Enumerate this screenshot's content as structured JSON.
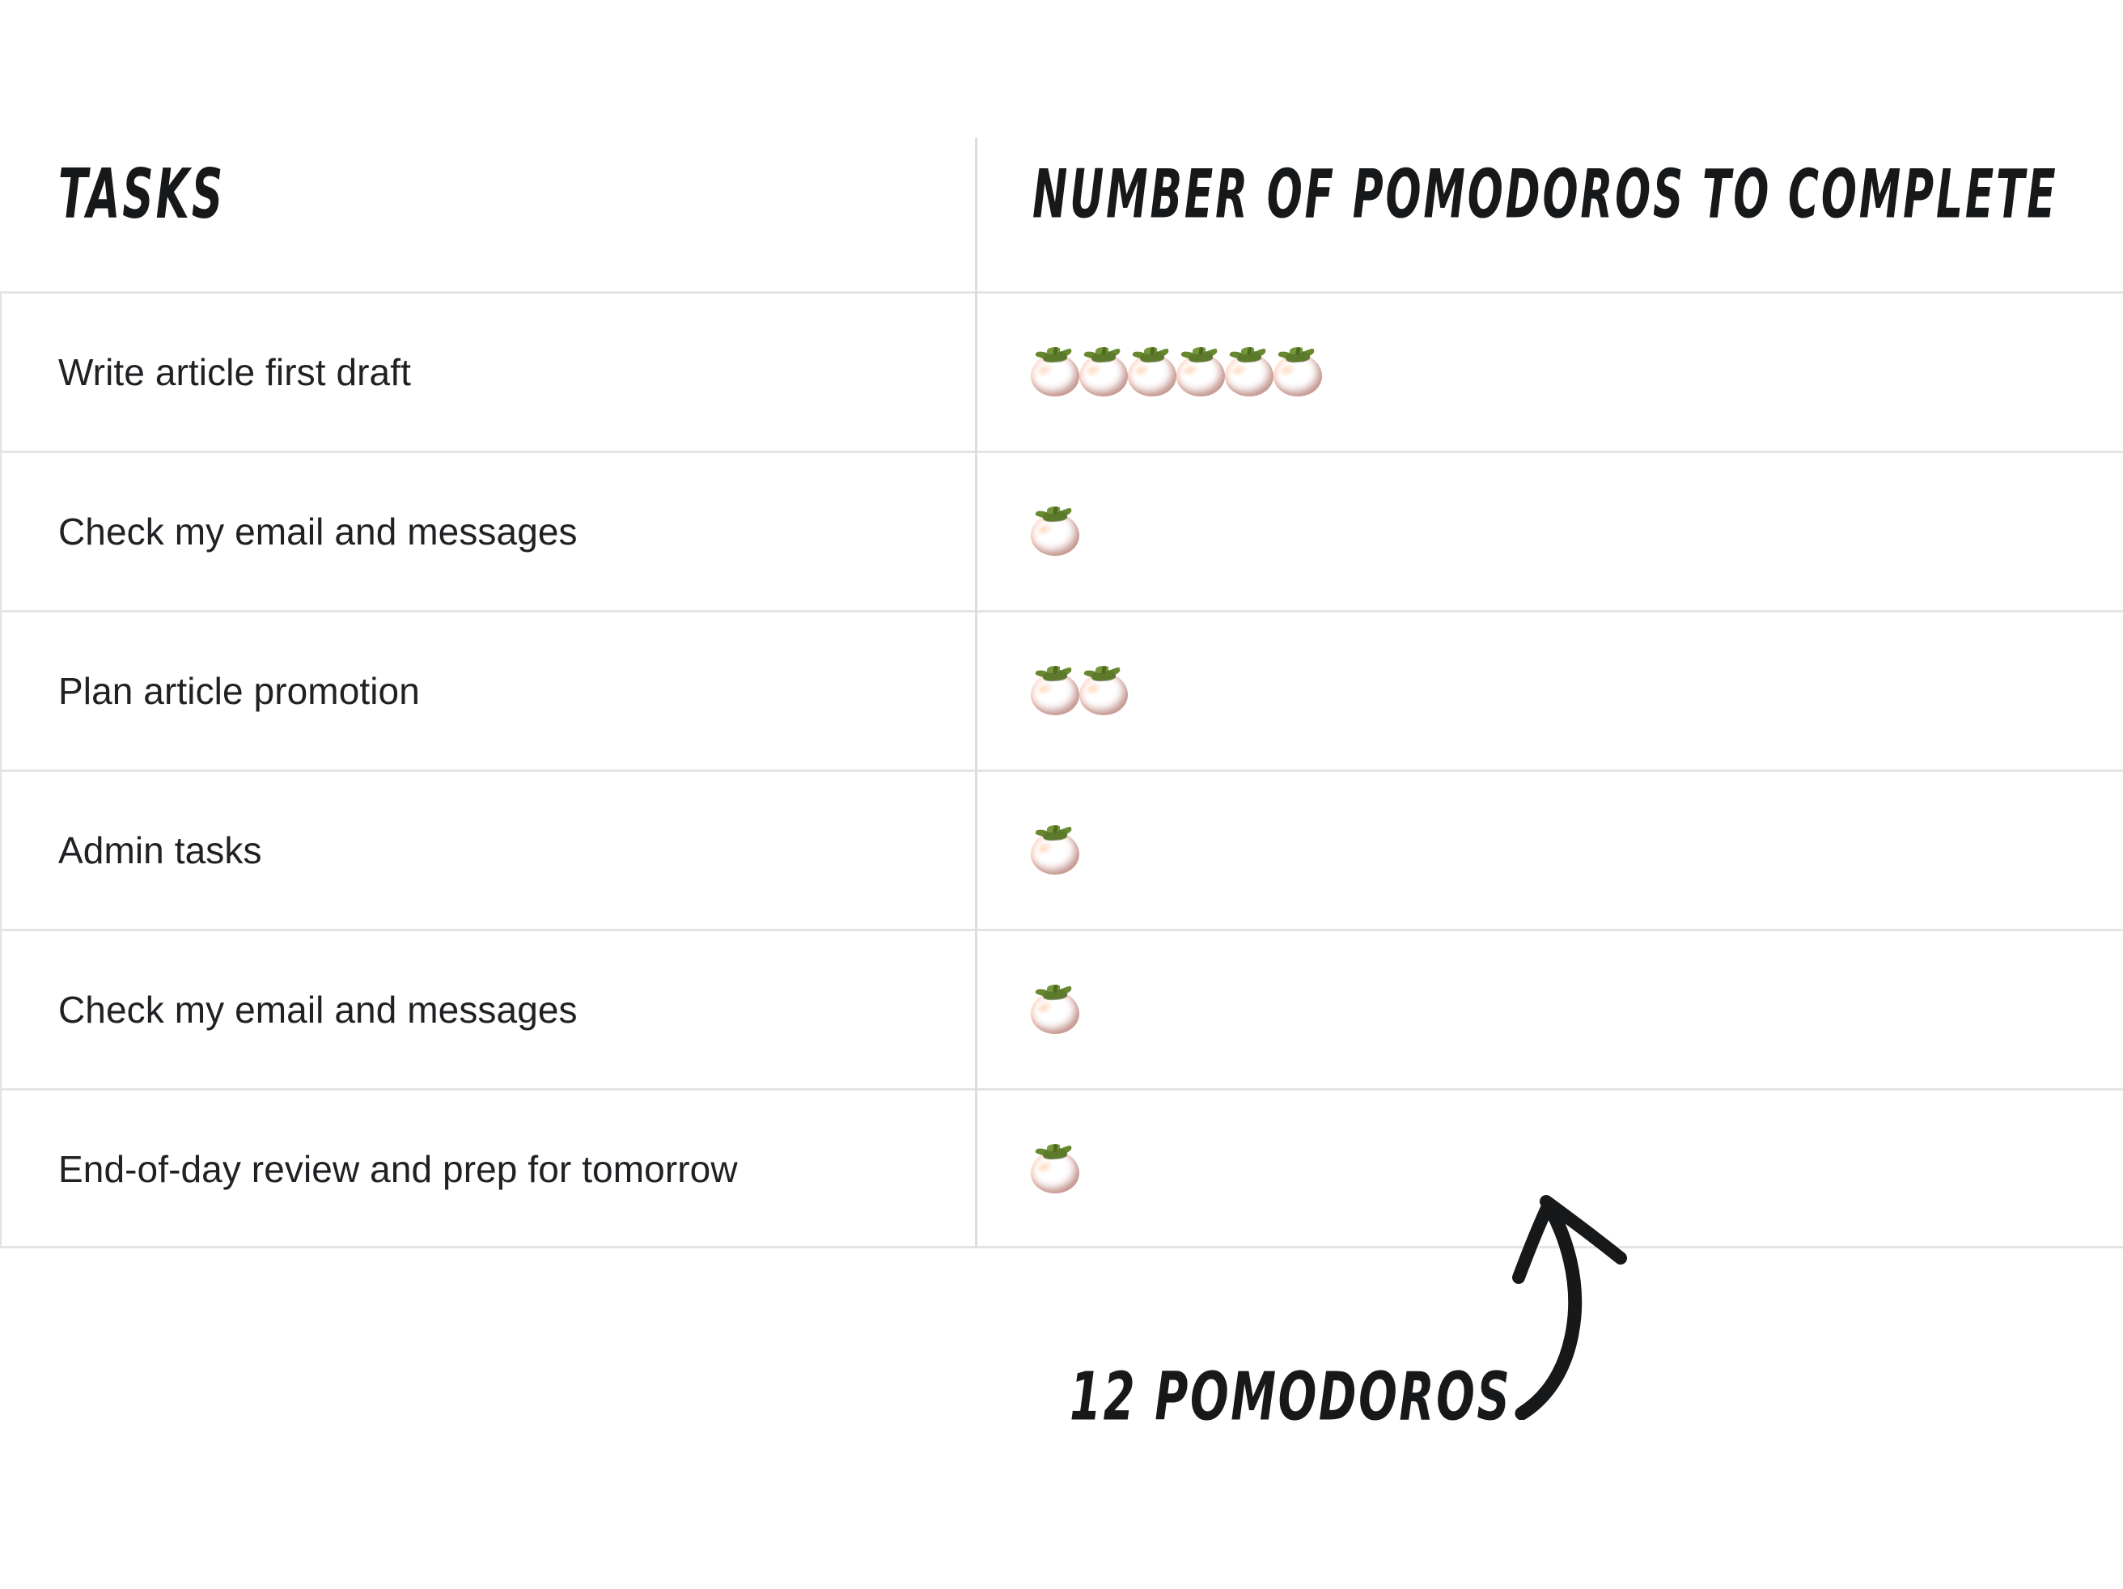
{
  "page": {
    "background_color": "#ffffff",
    "divider_color": "#e4e4e4",
    "text_color": "#202124",
    "accent_color": "#d8381c"
  },
  "table": {
    "columns": [
      {
        "key": "tasks",
        "label": "TASKS"
      },
      {
        "key": "pomodoros",
        "label": "NUMBER OF POMODOROS TO COMPLETE"
      }
    ],
    "rows": [
      {
        "task": "Write article first draft",
        "pomodoros": 6
      },
      {
        "task": "Check my email and messages",
        "pomodoros": 1
      },
      {
        "task": "Plan article promotion",
        "pomodoros": 2
      },
      {
        "task": "Admin tasks",
        "pomodoros": 1
      },
      {
        "task": "Check my email and messages",
        "pomodoros": 1
      },
      {
        "task": "End-of-day review and prep for tomorrow",
        "pomodoros": 1
      }
    ]
  },
  "annotation": {
    "total_label": "12 POMODOROS",
    "total_value": 12,
    "arrow": "curved-up-arrow-icon"
  },
  "icons": {
    "tomato": "tomato-icon"
  },
  "chart_data": {
    "type": "table",
    "title": "",
    "categories": [
      "Write article first draft",
      "Check my email and messages",
      "Plan article promotion",
      "Admin tasks",
      "Check my email and messages",
      "End-of-day review and prep for tomorrow"
    ],
    "values": [
      6,
      1,
      2,
      1,
      1,
      1
    ],
    "xlabel": "TASKS",
    "ylabel": "NUMBER OF POMODOROS TO COMPLETE",
    "unit": "pomodoro",
    "total": 12,
    "annotations": [
      "12 POMODOROS"
    ],
    "grid": true,
    "legend": "none"
  }
}
